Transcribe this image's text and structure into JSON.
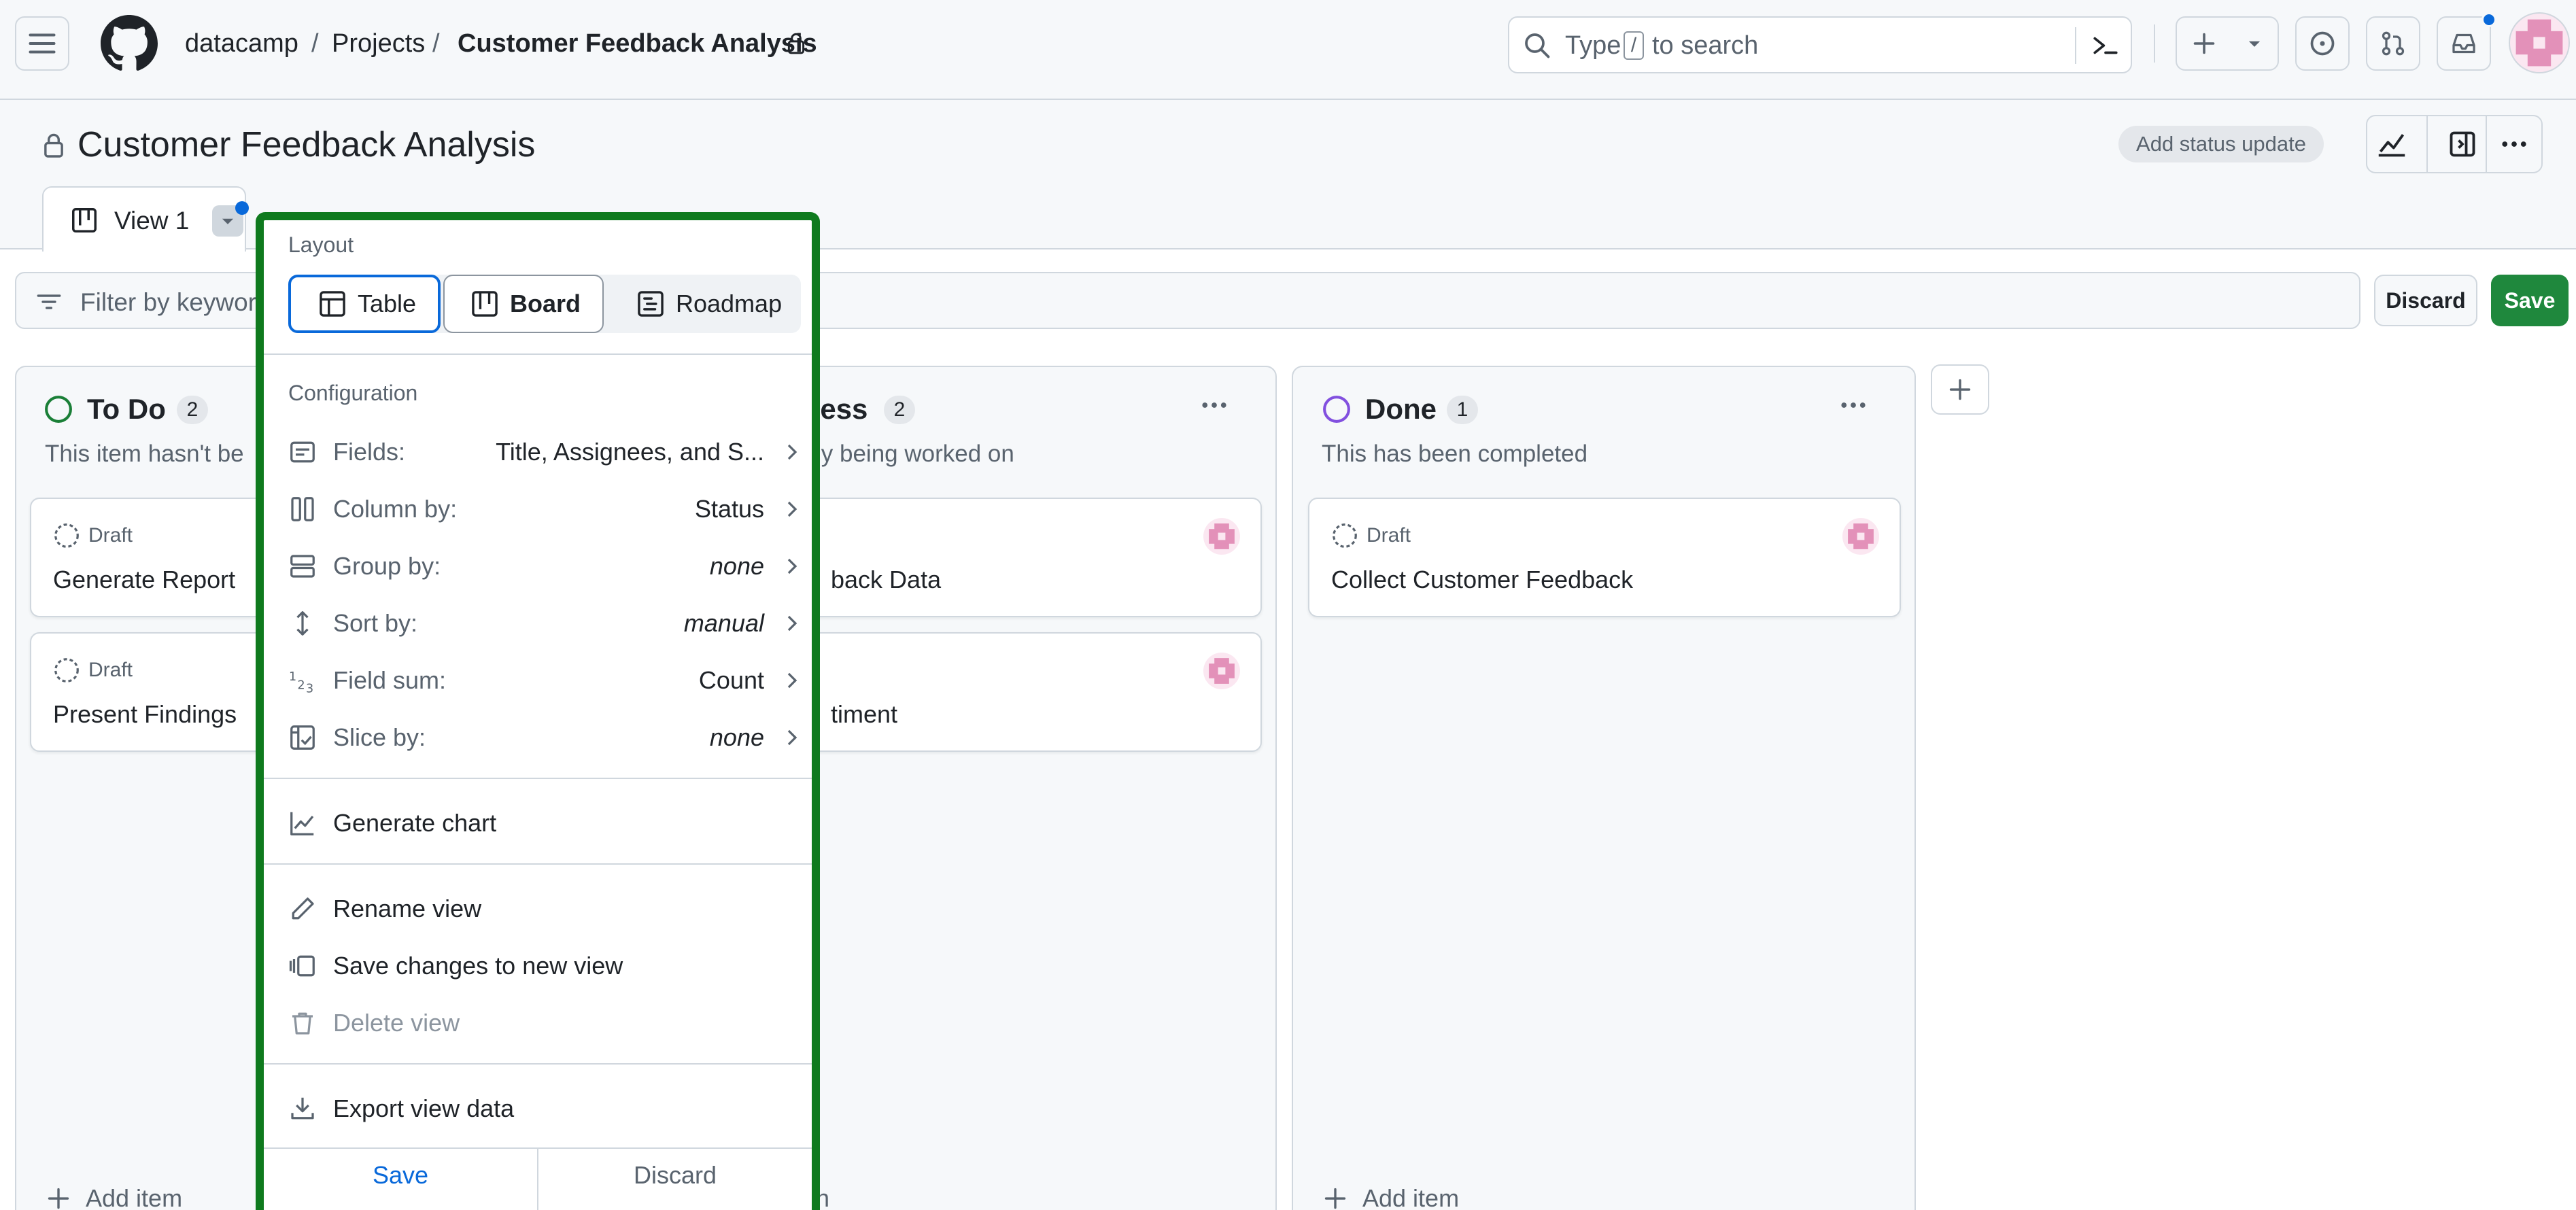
{
  "header": {
    "org": "datacamp",
    "sep1": "/",
    "projects": "Projects",
    "sep2": "/",
    "project": "Customer Feedback Analysis",
    "search_prefix": "Type",
    "search_key": "/",
    "search_suffix": "to search"
  },
  "project": {
    "title": "Customer Feedback Analysis",
    "status_update": "Add status update"
  },
  "tabs": [
    {
      "label": "View 1"
    }
  ],
  "filter": {
    "placeholder": "Filter by keywor",
    "discard": "Discard",
    "save": "Save"
  },
  "columns": [
    {
      "title": "To Do",
      "count": "2",
      "description": "This item hasn't be",
      "status_color": "#1a7f37",
      "cards": [
        {
          "state": "Draft",
          "title": "Generate Report"
        },
        {
          "state": "Draft",
          "title": "Present Findings"
        }
      ],
      "add_item": "Add item"
    },
    {
      "title": "ress",
      "count": "2",
      "description": "ly being worked on",
      "cards": [
        {
          "title": "back Data"
        },
        {
          "title": "timent"
        }
      ],
      "add_item": "n"
    },
    {
      "title": "Done",
      "count": "1",
      "description": "This has been completed",
      "status_color": "#8250df",
      "cards": [
        {
          "state": "Draft",
          "title": "Collect Customer Feedback"
        }
      ],
      "add_item": "Add item"
    }
  ],
  "menu": {
    "layout_label": "Layout",
    "layouts": [
      "Table",
      "Board",
      "Roadmap"
    ],
    "selected_layout": "Board",
    "configuration_label": "Configuration",
    "config_items": [
      {
        "label": "Fields:",
        "value": "Title, Assignees, and S...",
        "icon": "fields-icon"
      },
      {
        "label": "Column by:",
        "value": "Status",
        "icon": "column-icon"
      },
      {
        "label": "Group by:",
        "value": "none",
        "icon": "group-icon"
      },
      {
        "label": "Sort by:",
        "value": "manual",
        "icon": "sort-icon"
      },
      {
        "label": "Field sum:",
        "value": "Count",
        "icon": "field-sum-icon"
      },
      {
        "label": "Slice by:",
        "value": "none",
        "icon": "slice-icon"
      }
    ],
    "generate_chart": "Generate chart",
    "rename_view": "Rename view",
    "save_new_view": "Save changes to new view",
    "delete_view": "Delete view",
    "export_data": "Export view data",
    "footer_save": "Save",
    "footer_discard": "Discard"
  },
  "colors": {
    "accent_blue": "#0969da",
    "save_green": "#1f883d",
    "highlight_green": "#0f7a1e",
    "avatar_pink": "#e391b9"
  }
}
